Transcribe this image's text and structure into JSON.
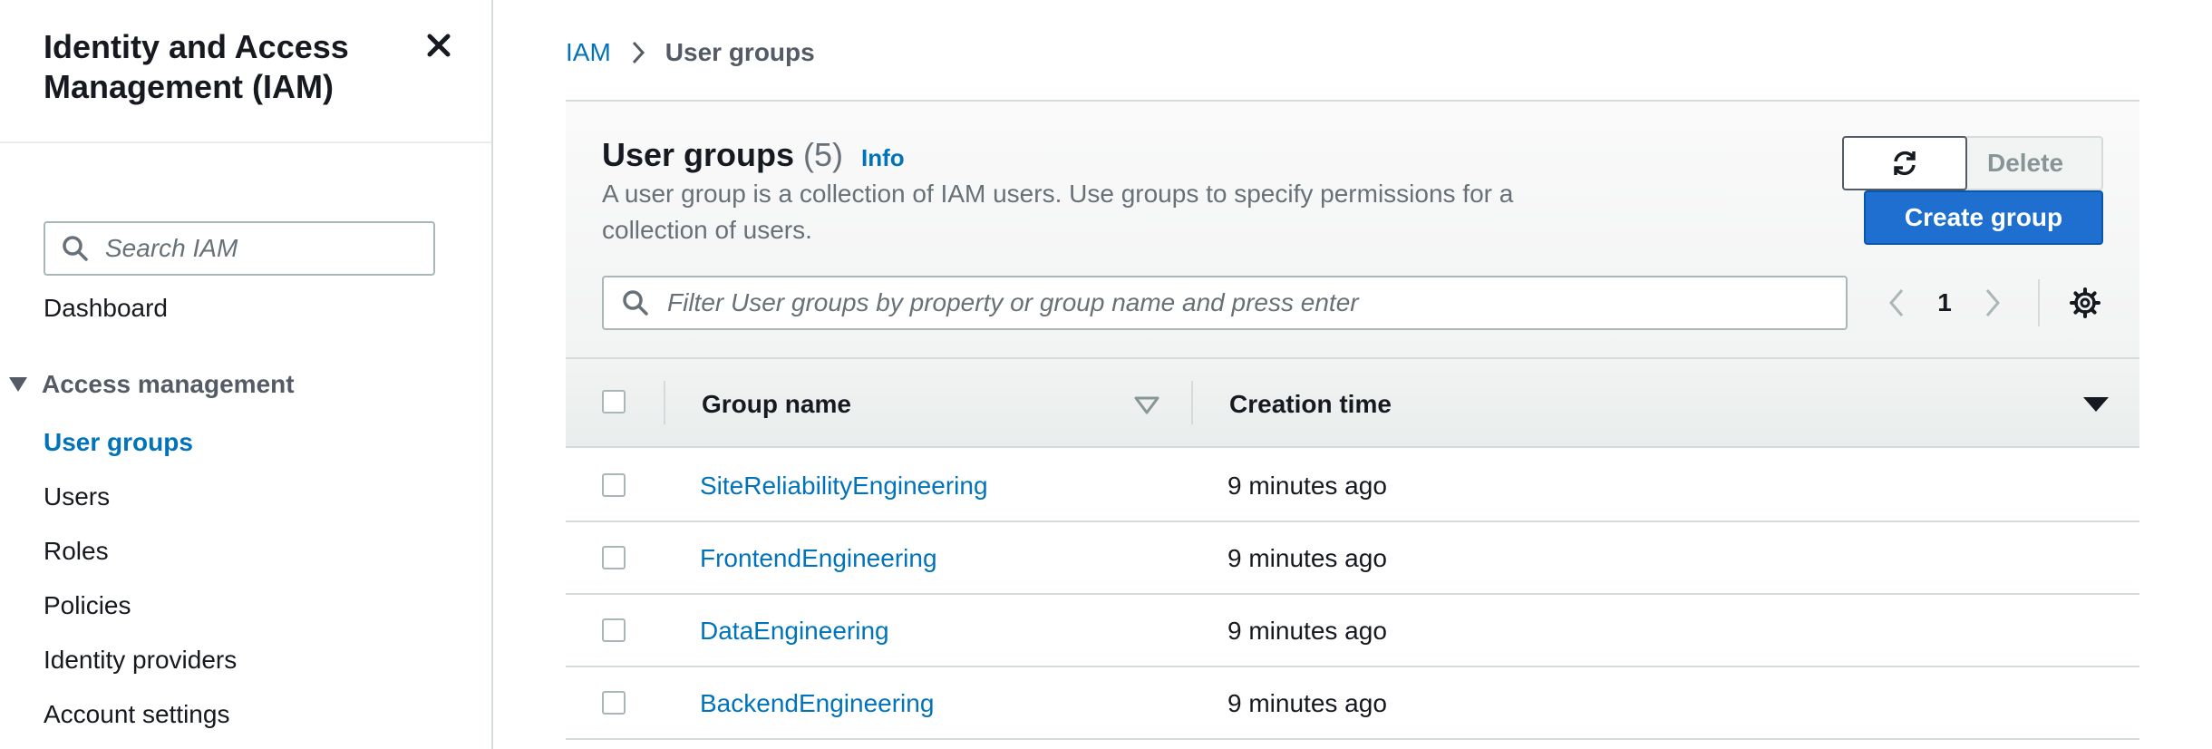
{
  "sidebar": {
    "title": "Identity and Access Management (IAM)",
    "search_placeholder": "Search IAM",
    "dashboard": "Dashboard",
    "section": "Access management",
    "items": [
      {
        "label": "User groups",
        "active": true
      },
      {
        "label": "Users",
        "active": false
      },
      {
        "label": "Roles",
        "active": false
      },
      {
        "label": "Policies",
        "active": false
      },
      {
        "label": "Identity providers",
        "active": false
      },
      {
        "label": "Account settings",
        "active": false
      }
    ]
  },
  "breadcrumb": {
    "root": "IAM",
    "current": "User groups"
  },
  "panel": {
    "title": "User groups",
    "count": "(5)",
    "info": "Info",
    "description": "A user group is a collection of IAM users. Use groups to specify permissions for a collection of users.",
    "refresh_icon": "refresh-icon",
    "delete_label": "Delete",
    "create_label": "Create group",
    "filter_placeholder": "Filter User groups by property or group name and press enter",
    "page": "1"
  },
  "table": {
    "columns": [
      "Group name",
      "Creation time"
    ],
    "rows": [
      {
        "name": "SiteReliabilityEngineering",
        "time": "9 minutes ago"
      },
      {
        "name": "FrontendEngineering",
        "time": "9 minutes ago"
      },
      {
        "name": "DataEngineering",
        "time": "9 minutes ago"
      },
      {
        "name": "BackendEngineering",
        "time": "9 minutes ago"
      }
    ]
  },
  "colors": {
    "link": "#0073bb",
    "primary_button": "#1f6fd1",
    "text": "#16191f",
    "muted": "#687078"
  }
}
